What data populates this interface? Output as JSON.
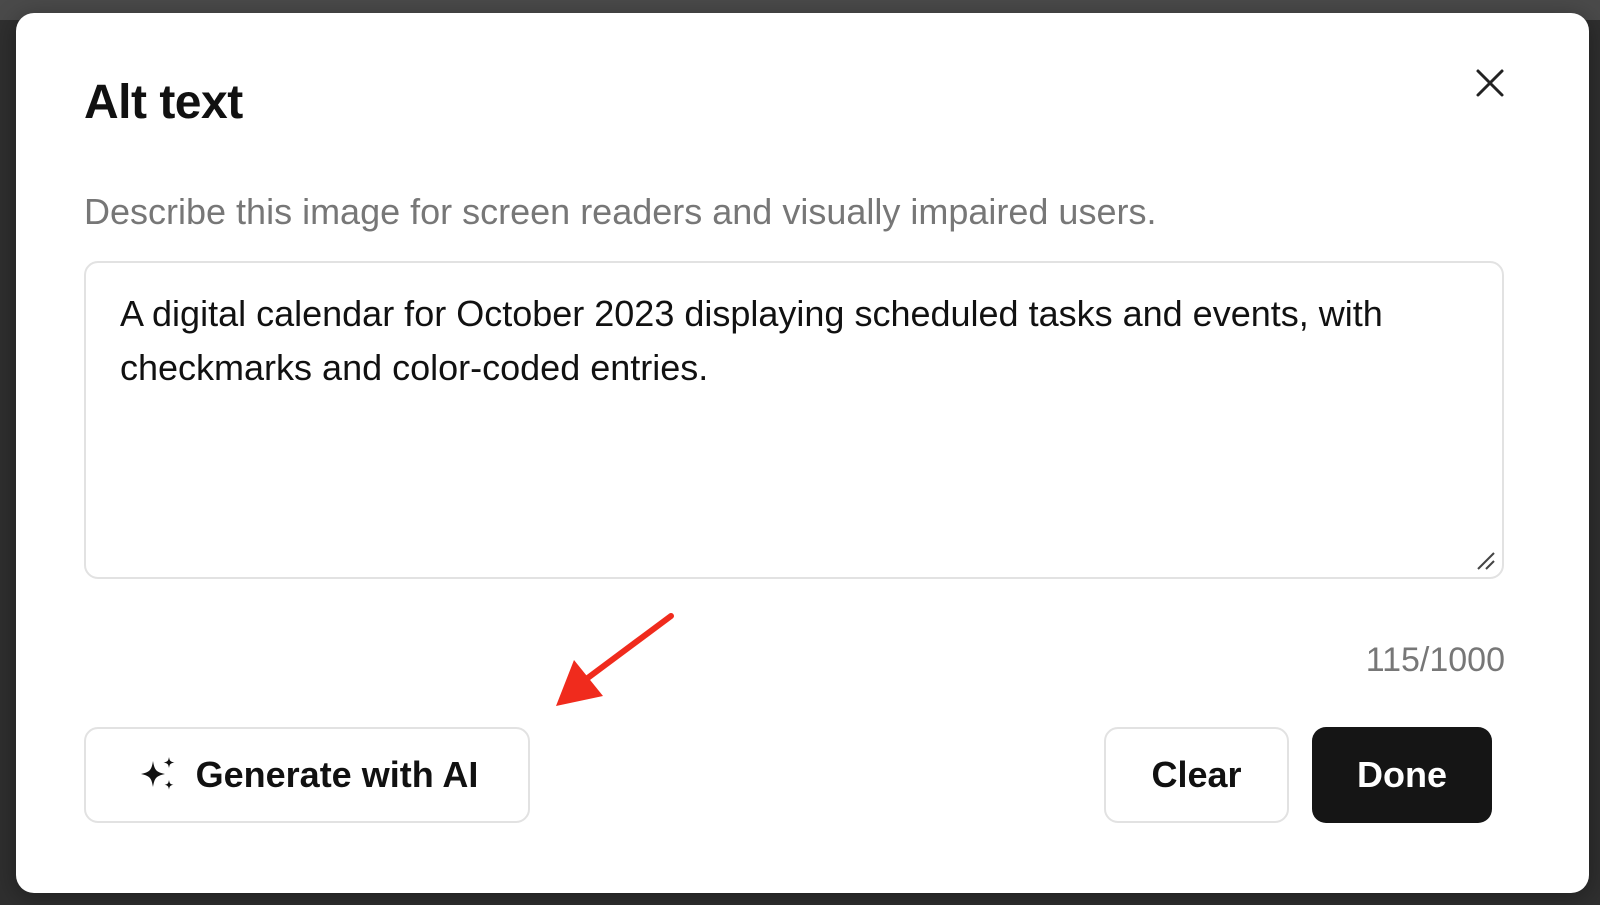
{
  "dialog": {
    "title": "Alt text",
    "description": "Describe this image for screen readers and visually impaired users.",
    "alt_text_value": "A digital calendar for October 2023 displaying scheduled tasks and events, with checkmarks and color-coded entries.",
    "char_count": "115/1000"
  },
  "buttons": {
    "generate_label": "Generate with AI",
    "clear_label": "Clear",
    "done_label": "Done"
  },
  "icons": {
    "close": "close-icon",
    "sparkle": "sparkle-icon",
    "resize": "resize-handle-icon"
  },
  "colors": {
    "primary_button": "#151515",
    "annotation_arrow": "#f02b1d",
    "muted_text": "#777777"
  }
}
